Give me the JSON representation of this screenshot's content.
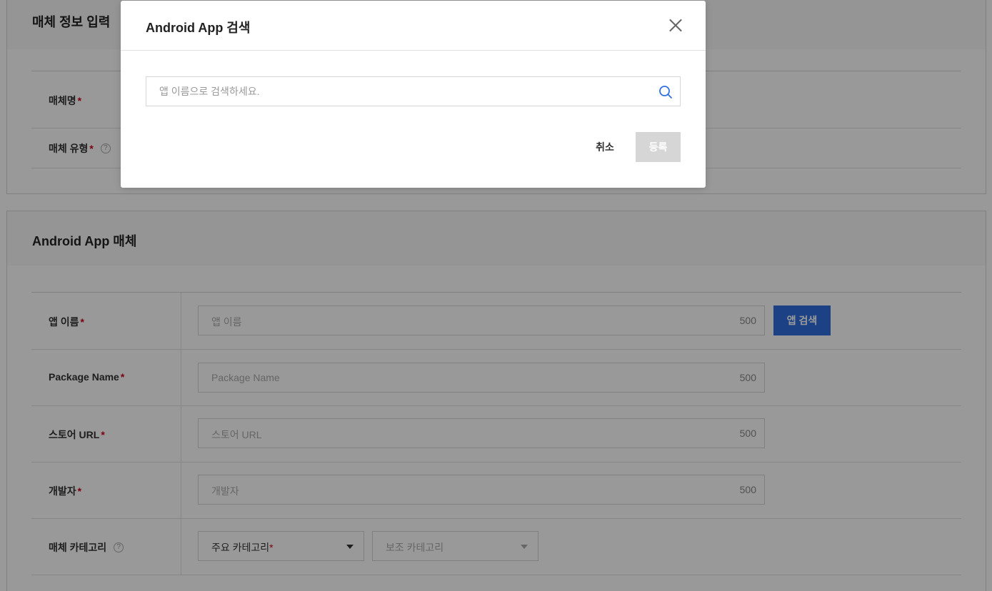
{
  "section1": {
    "title": "매체 정보 입력",
    "rows": [
      {
        "label": "매체명",
        "required": "*"
      },
      {
        "label": "매체 유형",
        "required": "*",
        "help": "?"
      }
    ]
  },
  "section2": {
    "title": "Android App 매체",
    "app_name": {
      "label": "앱 이름",
      "required": "*",
      "placeholder": "앱 이름",
      "count": "500",
      "button": "앱 검색"
    },
    "package_name": {
      "label": "Package Name",
      "required": "*",
      "placeholder": "Package Name",
      "count": "500"
    },
    "store_url": {
      "label": "스토어 URL",
      "required": "*",
      "placeholder": "스토어 URL",
      "count": "500"
    },
    "developer": {
      "label": "개발자",
      "required": "*",
      "placeholder": "개발자",
      "count": "500"
    },
    "category": {
      "label": "매체 카테고리",
      "help": "?",
      "primary": "주요 카테고리",
      "primary_required": "*",
      "secondary": "보조 카테고리"
    }
  },
  "modal": {
    "title": "Android App 검색",
    "search_placeholder": "앱 이름으로 검색하세요.",
    "cancel_label": "취소",
    "register_label": "등록"
  },
  "colors": {
    "accent": "#2f6fde",
    "required": "#d0021b",
    "disabled_button": "#d6d6d6",
    "overlay": "rgba(0,0,0,0.4)"
  },
  "icons": {
    "close": "close-icon",
    "search": "search-icon",
    "help": "help-circle-icon",
    "dropdown": "caret-down-icon"
  }
}
